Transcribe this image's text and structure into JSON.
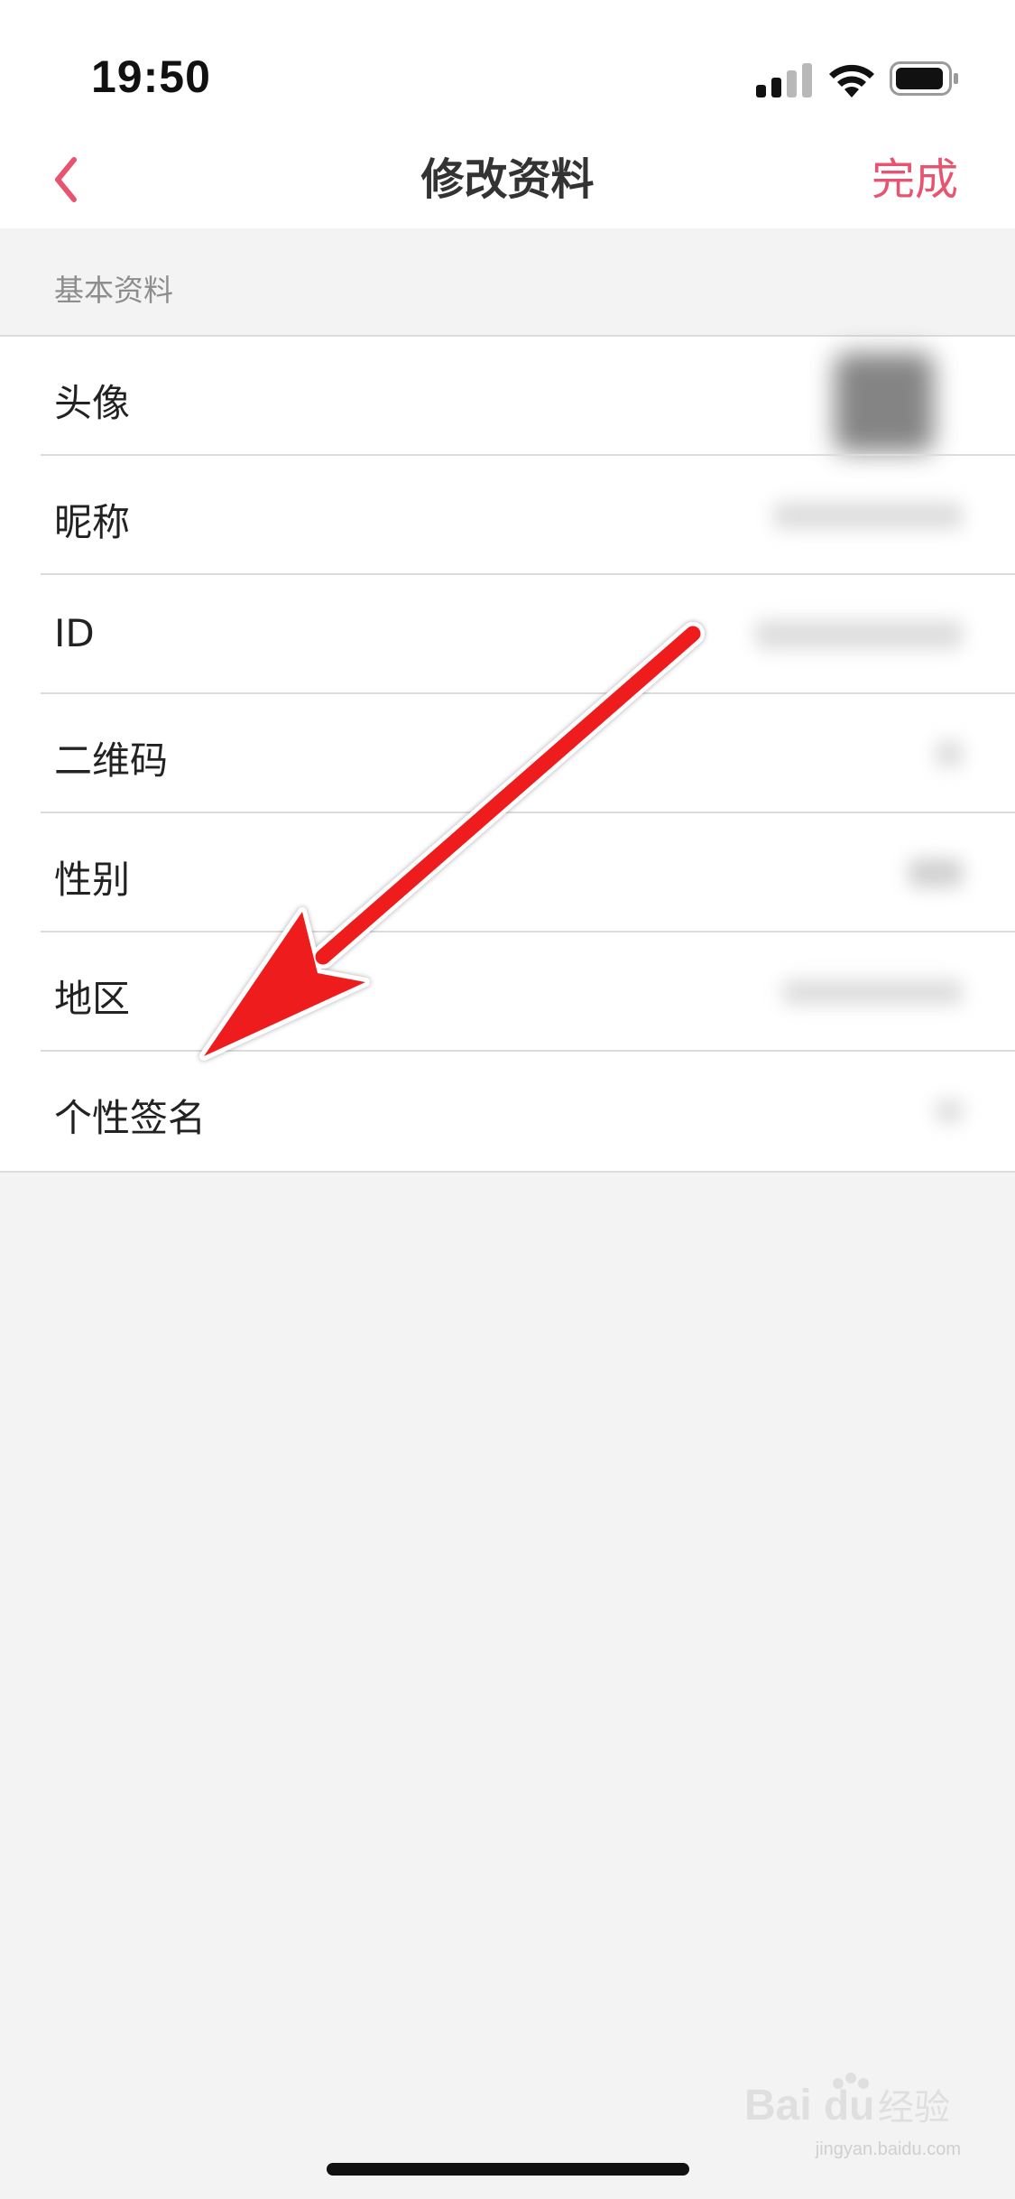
{
  "status_bar": {
    "time": "19:50"
  },
  "nav": {
    "title": "修改资料",
    "done_label": "完成",
    "accent_color": "#e8536f"
  },
  "section": {
    "header": "基本资料"
  },
  "rows": [
    {
      "label": "头像"
    },
    {
      "label": "昵称"
    },
    {
      "label": "ID"
    },
    {
      "label": "二维码"
    },
    {
      "label": "性别"
    },
    {
      "label": "地区"
    },
    {
      "label": "个性签名"
    }
  ],
  "annotation": {
    "type": "red-arrow",
    "color": "#ee1c1c",
    "points_to": "个性签名"
  },
  "watermark": {
    "logo": "Baidu经验",
    "url": "jingyan.baidu.com"
  }
}
